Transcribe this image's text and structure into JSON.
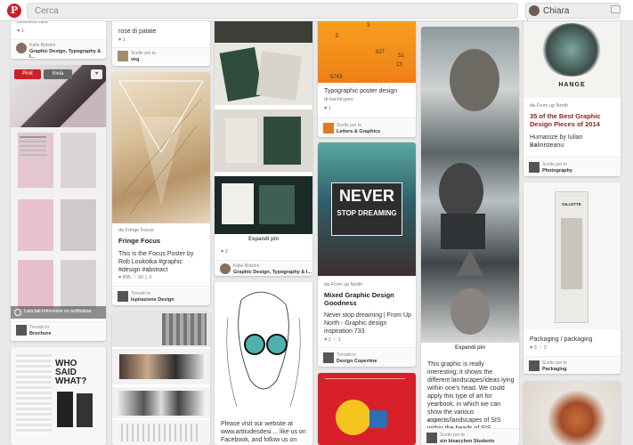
{
  "header": {
    "logo": "P",
    "search_placeholder": "Cerca",
    "user_name": "Chiara"
  },
  "col1": {
    "top_board_cat": "Business card",
    "top_stat": "♥ 1",
    "top_user": "Katie Bolsten",
    "top_user_board": "Graphic Design, Typography & I...",
    "pinit": "Pinit",
    "invia": "Invia",
    "heart": "♥",
    "overlay": "Lasciati informare su softbalias",
    "b2_small": "Trovato in",
    "b2_name": "Brochure"
  },
  "col2": {
    "top_text": "rose di patate",
    "top_stat": "♥ 1",
    "top_board_small": "Scelto per te",
    "top_board_name": "veg",
    "src": "da Fringe Focus",
    "title": "Fringe Focus",
    "desc": "This is the Focus Poster by Rob Loukotka #graphic #design #abstract",
    "stats": "♥ 895   ♡ 50   ▯ 3",
    "b_small": "Trovato in",
    "b_name": "Ispirazione Design"
  },
  "col3": {
    "expand": "Espandi pin",
    "stat": "♥ 2",
    "user": "Katie Bolsten",
    "user_board": "Graphic Design, Typography & I...",
    "desc": "Please visit our website at www.artitudesdesi.... like us on Facebook, and follow us on"
  },
  "col4": {
    "poster_nums": [
      "3",
      "827",
      "5",
      "51",
      "13",
      "5743"
    ],
    "top_title": "Typographic poster design",
    "top_src": "di bachtrypes",
    "top_stat": "♥ 1",
    "top_board_small": "Scelto per te",
    "top_board_name": "Letters & Graphics",
    "never": "NEVER",
    "stop": "STOP DREAMING",
    "src": "da From up North",
    "title": "Mixed Graphic Design Goodness",
    "desc": "Never stop dreaming | From Up North - Graphic design inspiration 733",
    "stats": "♥ 2   ♡ 1",
    "b_small": "Trovato in",
    "b_name": "Design Copertine"
  },
  "col5": {
    "expand": "Espandi pin",
    "desc": "This graphic is really interesting; it shows the different landscapes/ideas lying within one's head. We could apply this type of art for yearbook, in which we can show the various aspects/landscapes of SIS within the heads of SIS Students",
    "stats": "♥ 11   ♡ 1",
    "b_small": "Scelto per te",
    "b_name": "sin bisacchen Students"
  },
  "col6": {
    "poster_title": "HANGE",
    "src": "da From up North",
    "title": "35 of the Best Graphic Design Pieces of 2014",
    "desc": "Humanize by Iulian Balinisteanu",
    "stat": "♥ 4",
    "b_small": "Scelto per te",
    "b_name": "Photography",
    "pack_text": "GILLETTE",
    "pack_desc": "Packaging / packaging",
    "pack_stats": "♥ 3   ♡ 2",
    "b2_small": "Scelto per te",
    "b2_name": "Packaging"
  },
  "colors": {
    "brand": "#cb2027",
    "orange": "#f39a1d",
    "teal": "#4db2ae",
    "dark": "#2d2d2d"
  }
}
